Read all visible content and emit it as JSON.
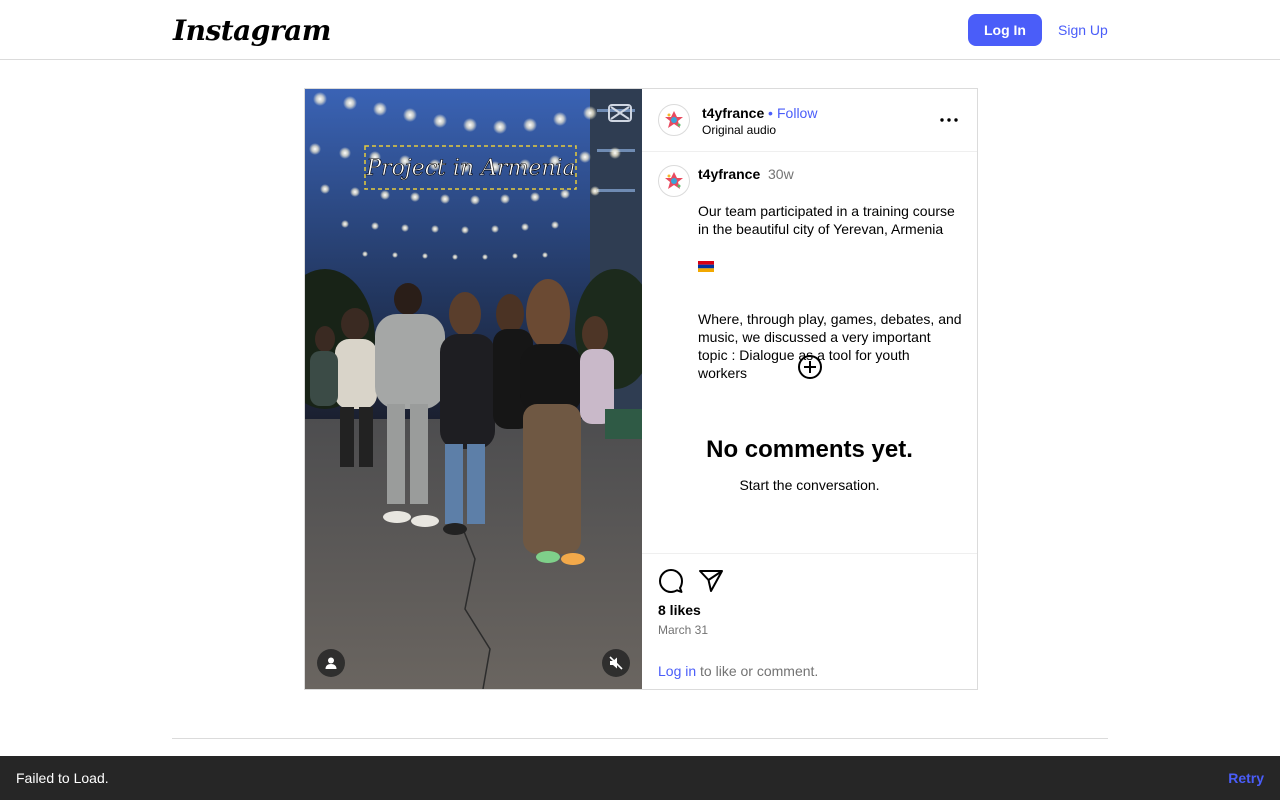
{
  "header": {
    "logo_text": "Instagram",
    "login_label": "Log In",
    "signup_label": "Sign Up"
  },
  "media": {
    "overlay_text": "Project in Armenia"
  },
  "post": {
    "username": "t4yfrance",
    "dot": "•",
    "follow_label": "Follow",
    "audio": "Original audio",
    "caption": {
      "username": "t4yfrance",
      "time": "30w",
      "line1": "Our team participated in a training course in the beautiful city of Yerevan, Armenia",
      "line2": "Where, through play, games, debates, and music, we discussed a very important topic : Dialogue as a tool for youth workers"
    },
    "no_comments": "No comments yet.",
    "start_conversation": "Start the conversation.",
    "likes": "8 likes",
    "date": "March 31",
    "login_link": "Log in",
    "login_suffix": " to like or comment."
  },
  "toast": {
    "message": "Failed to Load.",
    "retry_label": "Retry"
  },
  "colors": {
    "accent": "#4a5df9",
    "secondary_text": "#737373",
    "border": "#dbdbdb",
    "toast_bg": "#262626"
  },
  "icons": [
    "more-horizontal-icon",
    "add-comment-icon",
    "comment-icon",
    "share-icon",
    "user-tag-icon",
    "muted-speaker-icon",
    "armenia-flag-icon"
  ]
}
